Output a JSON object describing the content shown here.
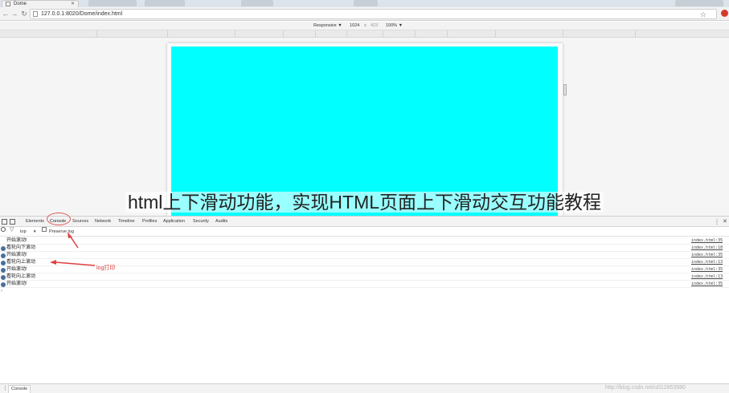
{
  "browser": {
    "tab_title": "Dome",
    "tab_icon": "page-icon",
    "url": "127.0.0.1:8020/Dome/index.html",
    "bookmark_icon": "star-icon"
  },
  "device_toolbar": {
    "mode": "Responsive ▼",
    "width": "1024",
    "separator": "x",
    "height": "423",
    "zoom": "100% ▼"
  },
  "page": {
    "content_color": "#00ffff"
  },
  "overlay_caption": "html上下滑动功能，实现HTML页面上下滑动交互功能教程",
  "devtools": {
    "tabs": [
      {
        "label": "Elements"
      },
      {
        "label": "Console"
      },
      {
        "label": "Sources"
      },
      {
        "label": "Network"
      },
      {
        "label": "Timeline"
      },
      {
        "label": "Profiles"
      },
      {
        "label": "Application"
      },
      {
        "label": "Security"
      },
      {
        "label": "Audits"
      }
    ],
    "active_tab": "Console",
    "filter": {
      "context": "top",
      "context_arrow": "▼",
      "preserve_log": "Preserve log"
    },
    "console_rows": [
      {
        "badge": false,
        "message": "开始滚动!",
        "source": "index.html:35"
      },
      {
        "badge": true,
        "message": "看轮向下滚动",
        "source": "index.html:18"
      },
      {
        "badge": true,
        "message": "开始滚动!",
        "source": "index.html:35"
      },
      {
        "badge": true,
        "message": "看轮向上滚动",
        "source": "index.html:13"
      },
      {
        "badge": true,
        "message": "开始滚动!",
        "source": "index.html:35"
      },
      {
        "badge": true,
        "message": "看轮向上滚动",
        "source": "index.html:13"
      },
      {
        "badge": true,
        "message": "开始滚动!",
        "source": "index.html:35"
      }
    ],
    "prompt": "›",
    "drawer_tab": "Console"
  },
  "annotations": {
    "log_label": "log打印",
    "color": "#d83a3a"
  },
  "watermark": "http://blog.csdn.net/u012853980"
}
